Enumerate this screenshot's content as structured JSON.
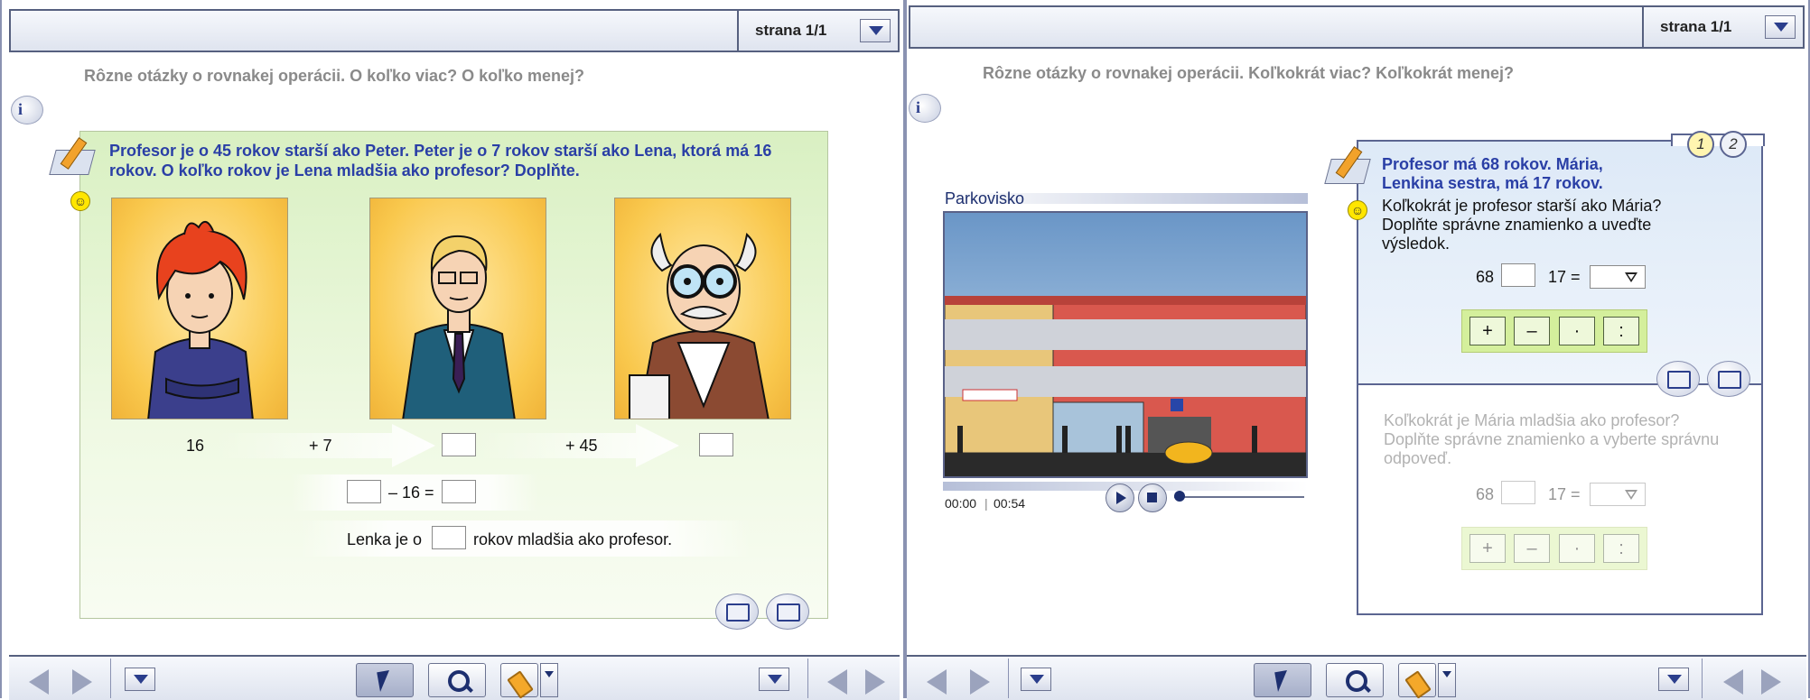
{
  "left": {
    "page_label": "strana  1/1",
    "question_title": "Rôzne otázky o rovnakej operácii. O koľko viac? O koľko menej?",
    "info_label": "i",
    "exercise_text": "Profesor je o 45 rokov starší ako Peter. Peter je o 7 rokov starší ako Lena, ktorá má 16 rokov. O koľko rokov je Lena mladšia ako profesor? Doplňte.",
    "chain": {
      "start": "16",
      "step1": "+ 7",
      "step2": "+ 45"
    },
    "equation": {
      "op": "– 16 ="
    },
    "sentence": {
      "before": "Lenka je o",
      "after": "rokov mladšia ako profesor."
    }
  },
  "right": {
    "page_label": "strana  1/1",
    "question_title": "Rôzne otázky o rovnakej operácii. Koľkokrát viac? Koľkokrát menej?",
    "info_label": "i",
    "video": {
      "title": "Parkovisko",
      "time_current": "00:00",
      "separator": "|",
      "time_total": "00:54",
      "progress": 0
    },
    "tabs": [
      "1",
      "2"
    ],
    "exercise_bold": "Profesor má 68 rokov. Mária, Lenkina sestra, má 17 rokov.",
    "q1_text": "Koľkokrát je profesor starší ako Mária? Doplňte správne znamienko a uveďte výsledok.",
    "q1_eq": {
      "a": "68",
      "b": "17 ="
    },
    "q2_text": "Koľkokrát je Mária mladšia ako profesor? Doplňte správne znamienko a vyberte správnu odpoveď.",
    "q2_eq": {
      "a": "68",
      "b": "17 ="
    },
    "operators": [
      "+",
      "–",
      "·",
      ":"
    ]
  },
  "colors": {
    "accent": "#2a3fa6",
    "frame": "#56607f",
    "green_panel": "#d9f0c2",
    "blue_panel": "#dde9f7"
  },
  "icons": {
    "pencil": "pencil-paper-icon",
    "smiley": "smiley-icon",
    "reset": "reset-icon",
    "check": "check-icon"
  }
}
